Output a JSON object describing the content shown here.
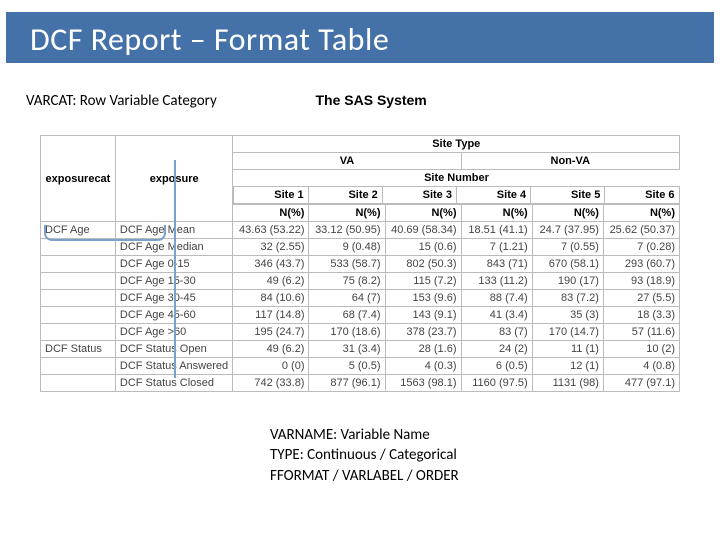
{
  "header": {
    "title": "DCF Report – Format Table"
  },
  "labels": {
    "varcat": "VARCAT: Row Variable Category",
    "sas_title": "The SAS System",
    "varname_line1": "VARNAME: Variable Name",
    "varname_line2": "TYPE: Continuous / Categorical",
    "varname_line3": "FFORMAT / VARLABEL / ORDER"
  },
  "table": {
    "super_header": "Site Type",
    "group_headers": [
      "VA",
      "Non-VA"
    ],
    "site_row_label": "Site Number",
    "sites": [
      "Site 1",
      "Site 2",
      "Site 3",
      "Site 4",
      "Site 5",
      "Site 6"
    ],
    "metric_header": "N(%)",
    "row_headers": [
      "exposurecat",
      "exposure"
    ],
    "rows": [
      {
        "cat": "DCF Age",
        "name": "DCF Age Mean",
        "v": [
          "43.63 (53.22)",
          "33.12 (50.95)",
          "40.69 (58.34)",
          "18.51 (41.1)",
          "24.7 (37.95)",
          "25.62 (50.37)"
        ]
      },
      {
        "cat": "",
        "name": "DCF Age Median",
        "v": [
          "32 (2.55)",
          "9 (0.48)",
          "15 (0.6)",
          "7 (1.21)",
          "7 (0.55)",
          "7 (0.28)"
        ]
      },
      {
        "cat": "",
        "name": "DCF Age 0-15",
        "v": [
          "346 (43.7)",
          "533 (58.7)",
          "802 (50.3)",
          "843 (71)",
          "670 (58.1)",
          "293 (60.7)"
        ]
      },
      {
        "cat": "",
        "name": "DCF Age 15-30",
        "v": [
          "49 (6.2)",
          "75 (8.2)",
          "115 (7.2)",
          "133 (11.2)",
          "190 (17)",
          "93 (18.9)"
        ]
      },
      {
        "cat": "",
        "name": "DCF Age 30-45",
        "v": [
          "84 (10.6)",
          "64 (7)",
          "153 (9.6)",
          "88 (7.4)",
          "83 (7.2)",
          "27 (5.5)"
        ]
      },
      {
        "cat": "",
        "name": "DCF Age 45-60",
        "v": [
          "117 (14.8)",
          "68 (7.4)",
          "143 (9.1)",
          "41 (3.4)",
          "35 (3)",
          "18 (3.3)"
        ]
      },
      {
        "cat": "",
        "name": "DCF Age >60",
        "v": [
          "195 (24.7)",
          "170 (18.6)",
          "378 (23.7)",
          "83 (7)",
          "170 (14.7)",
          "57 (11.6)"
        ]
      },
      {
        "cat": "DCF Status",
        "name": "DCF Status Open",
        "v": [
          "49 (6.2)",
          "31 (3.4)",
          "28 (1.6)",
          "24 (2)",
          "11 (1)",
          "10 (2)"
        ]
      },
      {
        "cat": "",
        "name": "DCF Status Answered",
        "v": [
          "0 (0)",
          "5 (0.5)",
          "4 (0.3)",
          "6 (0.5)",
          "12 (1)",
          "4 (0.8)"
        ]
      },
      {
        "cat": "",
        "name": "DCF Status Closed",
        "v": [
          "742 (33.8)",
          "877 (96.1)",
          "1563 (98.1)",
          "1160 (97.5)",
          "1131 (98)",
          "477 (97.1)"
        ]
      }
    ]
  }
}
